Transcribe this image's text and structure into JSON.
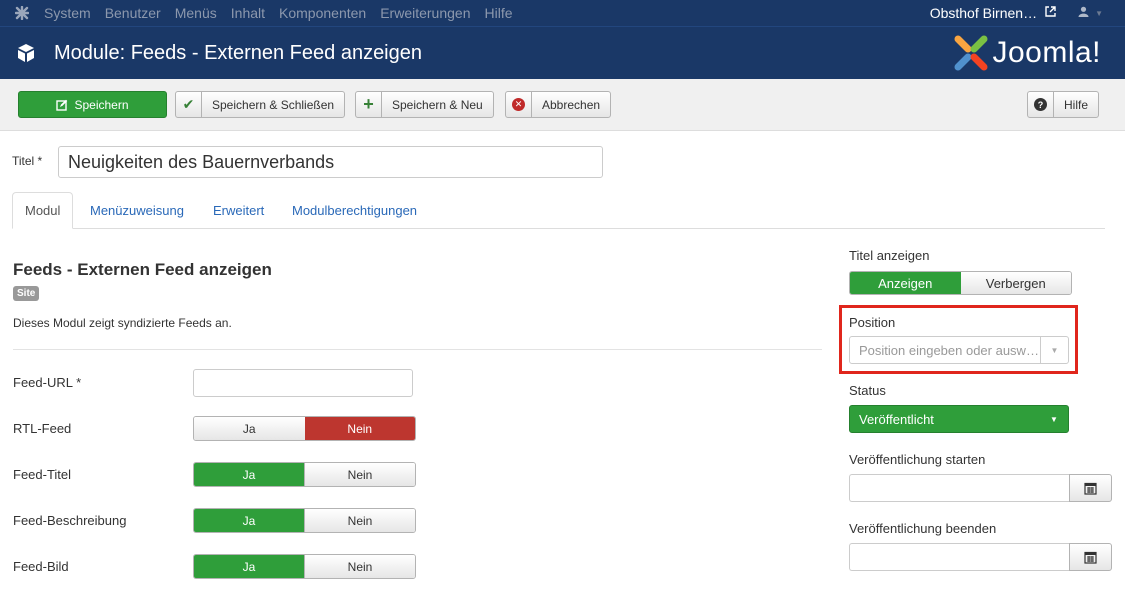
{
  "topnav": {
    "menu": [
      "System",
      "Benutzer",
      "Menüs",
      "Inhalt",
      "Komponenten",
      "Erweiterungen",
      "Hilfe"
    ],
    "site_name": "Obsthof Birnen…",
    "external_icon": "external-link-icon",
    "user_icon": "user-icon"
  },
  "header": {
    "title": "Module: Feeds - Externen Feed anzeigen",
    "brand": "Joomla!"
  },
  "toolbar": {
    "save_label": "Speichern",
    "save_close_label": "Speichern & Schließen",
    "save_new_label": "Speichern & Neu",
    "cancel_label": "Abbrechen",
    "help_label": "Hilfe"
  },
  "title_field": {
    "label": "Titel *",
    "value": "Neuigkeiten des Bauernverbands"
  },
  "tabs": [
    "Modul",
    "Menüzuweisung",
    "Erweitert",
    "Modulberechtigungen"
  ],
  "module": {
    "heading": "Feeds - Externen Feed anzeigen",
    "badge": "Site",
    "description": "Dieses Modul zeigt syndizierte Feeds an."
  },
  "fields": {
    "feed_url_label": "Feed-URL *",
    "feed_url_value": "",
    "rtl_label": "RTL-Feed",
    "feed_title_label": "Feed-Titel",
    "feed_desc_label": "Feed-Beschreibung",
    "feed_image_label": "Feed-Bild",
    "yes": "Ja",
    "no": "Nein"
  },
  "sidebar": {
    "show_title_label": "Titel anzeigen",
    "show_label": "Anzeigen",
    "hide_label": "Verbergen",
    "position_label": "Position",
    "position_placeholder": "Position eingeben oder ausw…",
    "status_label": "Status",
    "status_value": "Veröffentlicht",
    "publish_up_label": "Veröffentlichung starten",
    "publish_down_label": "Veröffentlichung beenden"
  },
  "colors": {
    "nav_bg": "#1a3867",
    "success": "#2f9e3a",
    "danger": "#bd362f",
    "highlight": "#e0261c",
    "link": "#2a69b8"
  }
}
